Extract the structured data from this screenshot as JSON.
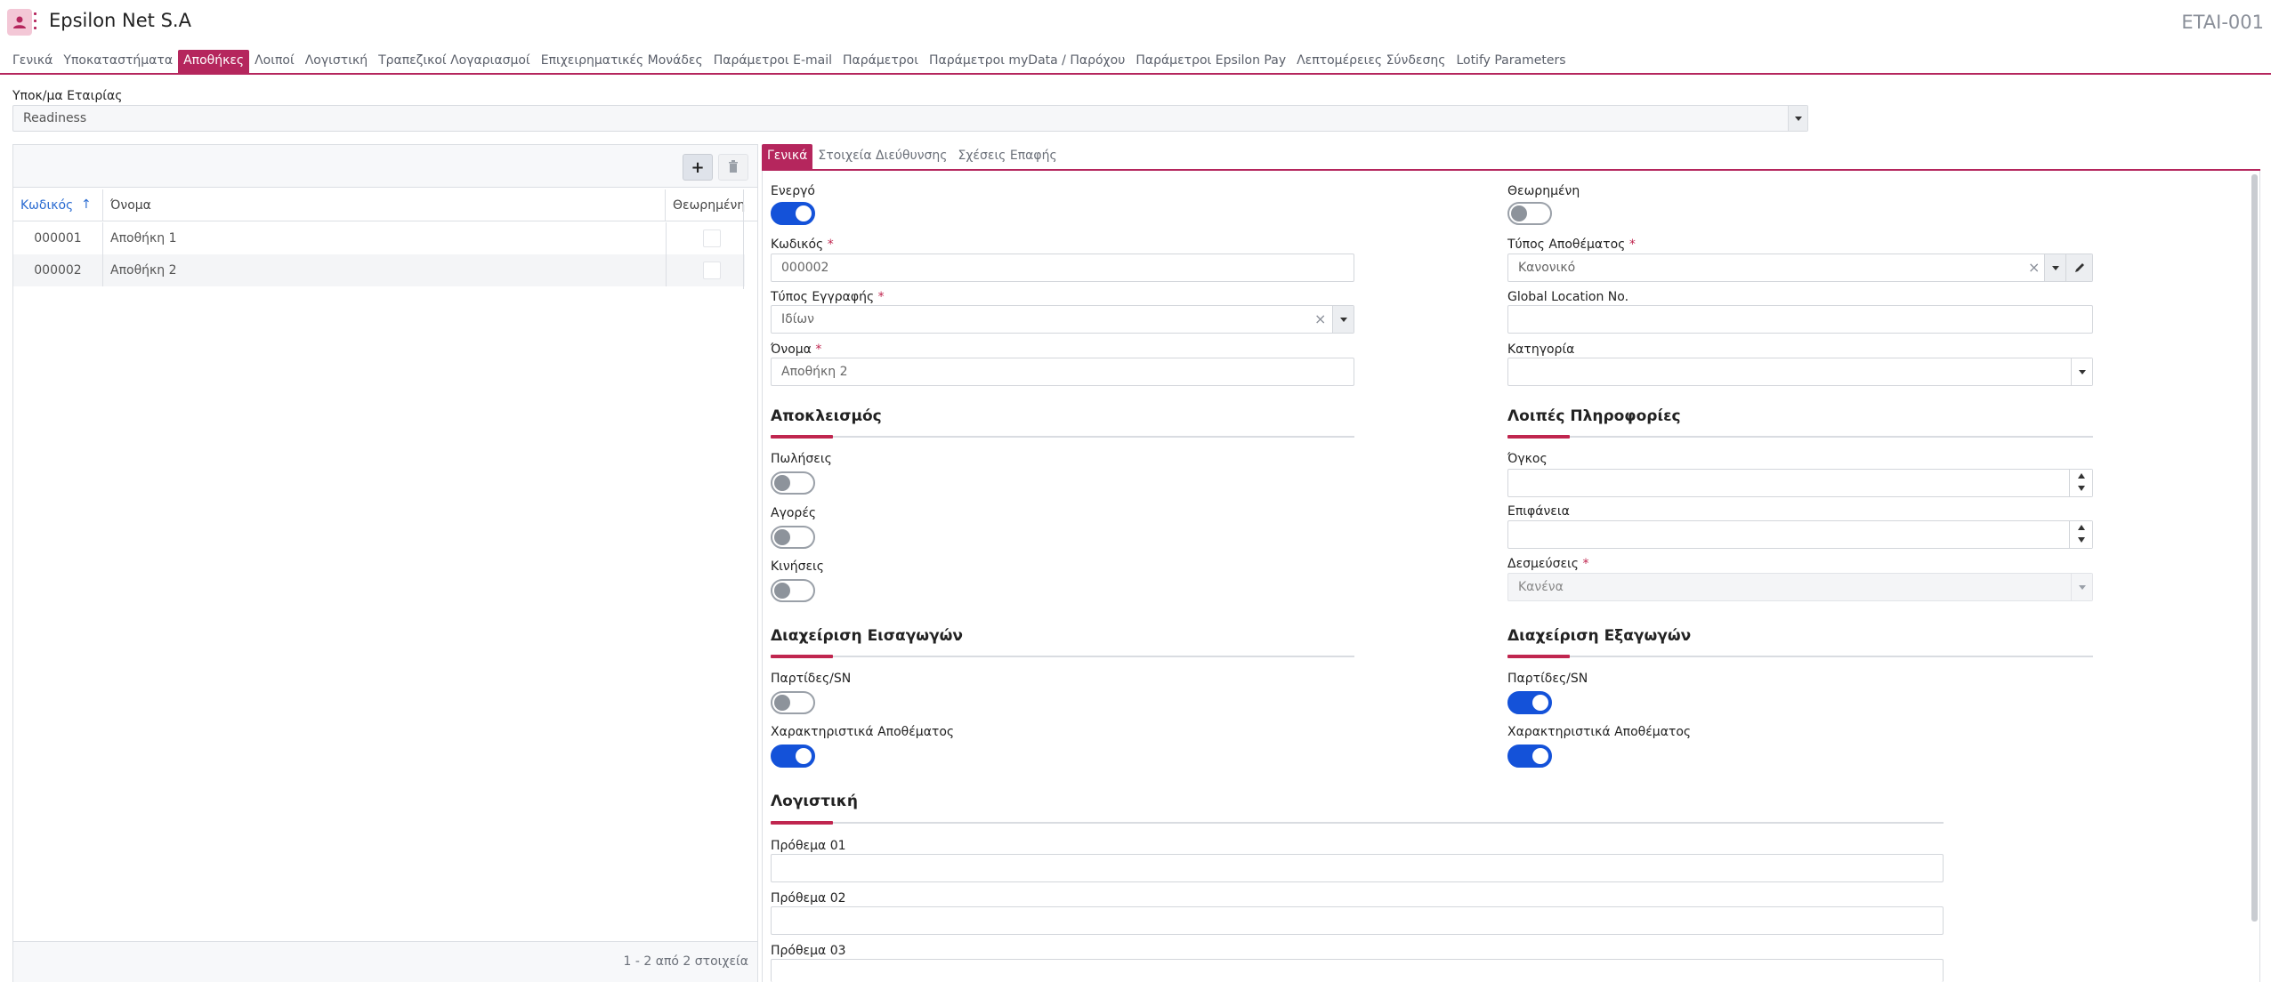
{
  "header": {
    "company": "Epsilon Net S.A",
    "entity_code": "ETAI-001"
  },
  "top_tabs": [
    {
      "label": "Γενικά",
      "active": false
    },
    {
      "label": "Υποκαταστήματα",
      "active": false
    },
    {
      "label": "Αποθήκες",
      "active": true
    },
    {
      "label": "Λοιποί",
      "active": false
    },
    {
      "label": "Λογιστική",
      "active": false
    },
    {
      "label": "Τραπεζικοί Λογαριασμοί",
      "active": false
    },
    {
      "label": "Επιχειρηματικές Μονάδες",
      "active": false
    },
    {
      "label": "Παράμετροι E-mail",
      "active": false
    },
    {
      "label": "Παράμετροι",
      "active": false
    },
    {
      "label": "Παράμετροι myData / Παρόχου",
      "active": false
    },
    {
      "label": "Παράμετροι Epsilon Pay",
      "active": false
    },
    {
      "label": "Λεπτομέρειες Σύνδεσης",
      "active": false
    },
    {
      "label": "Lotify Parameters",
      "active": false
    }
  ],
  "subsidiary": {
    "label": "Υποκ/μα Εταιρίας",
    "value": "Readiness"
  },
  "grid": {
    "add_icon": "plus-icon",
    "delete_icon": "trash-icon",
    "columns": {
      "code": "Κωδικός",
      "name": "Όνομα",
      "viewed": "Θεωρημένη"
    },
    "rows": [
      {
        "code": "000001",
        "name": "Αποθήκη 1",
        "viewed": false
      },
      {
        "code": "000002",
        "name": "Αποθήκη 2",
        "viewed": false
      }
    ],
    "footer": "1 - 2 από 2 στοιχεία"
  },
  "detail_tabs": [
    {
      "label": "Γενικά",
      "active": true
    },
    {
      "label": "Στοιχεία Διεύθυνσης",
      "active": false
    },
    {
      "label": "Σχέσεις Επαφής",
      "active": false
    }
  ],
  "form": {
    "active_label": "Ενεργό",
    "active_on": true,
    "viewed_label": "Θεωρημένη",
    "viewed_on": false,
    "code_label": "Κωδικός",
    "code_value": "000002",
    "stock_type_label": "Τύπος Αποθέματος",
    "stock_type_value": "Κανονικό",
    "record_type_label": "Τύπος Εγγραφής",
    "record_type_value": "Ιδίων",
    "gln_label": "Global Location No.",
    "gln_value": "",
    "name_label": "Όνομα",
    "name_value": "Αποθήκη 2",
    "category_label": "Κατηγορία",
    "category_value": "",
    "required_mark": "*",
    "exclusion_title": "Αποκλεισμός",
    "sales_label": "Πωλήσεις",
    "sales_on": false,
    "purchases_label": "Αγορές",
    "purchases_on": false,
    "movements_label": "Κινήσεις",
    "movements_on": false,
    "other_info_title": "Λοιπές Πληροφορίες",
    "volume_label": "Όγκος",
    "volume_value": "",
    "surface_label": "Επιφάνεια",
    "surface_value": "",
    "commitments_label": "Δεσμεύσεις",
    "commitments_value": "Κανένα",
    "imports_title": "Διαχείριση Εισαγωγών",
    "imports_lots_label": "Παρτίδες/SN",
    "imports_lots_on": false,
    "imports_attr_label": "Χαρακτηριστικά Αποθέματος",
    "imports_attr_on": true,
    "exports_title": "Διαχείριση Εξαγωγών",
    "exports_lots_label": "Παρτίδες/SN",
    "exports_lots_on": true,
    "exports_attr_label": "Χαρακτηριστικά Αποθέματος",
    "exports_attr_on": true,
    "accounting_title": "Λογιστική",
    "prefix01_label": "Πρόθεμα 01",
    "prefix01_value": "",
    "prefix02_label": "Πρόθεμα 02",
    "prefix02_value": "",
    "prefix03_label": "Πρόθεμα 03",
    "prefix03_value": ""
  },
  "colors": {
    "accent": "#b5265d",
    "toggle_on": "#1452d9",
    "link": "#2a6bd1"
  }
}
